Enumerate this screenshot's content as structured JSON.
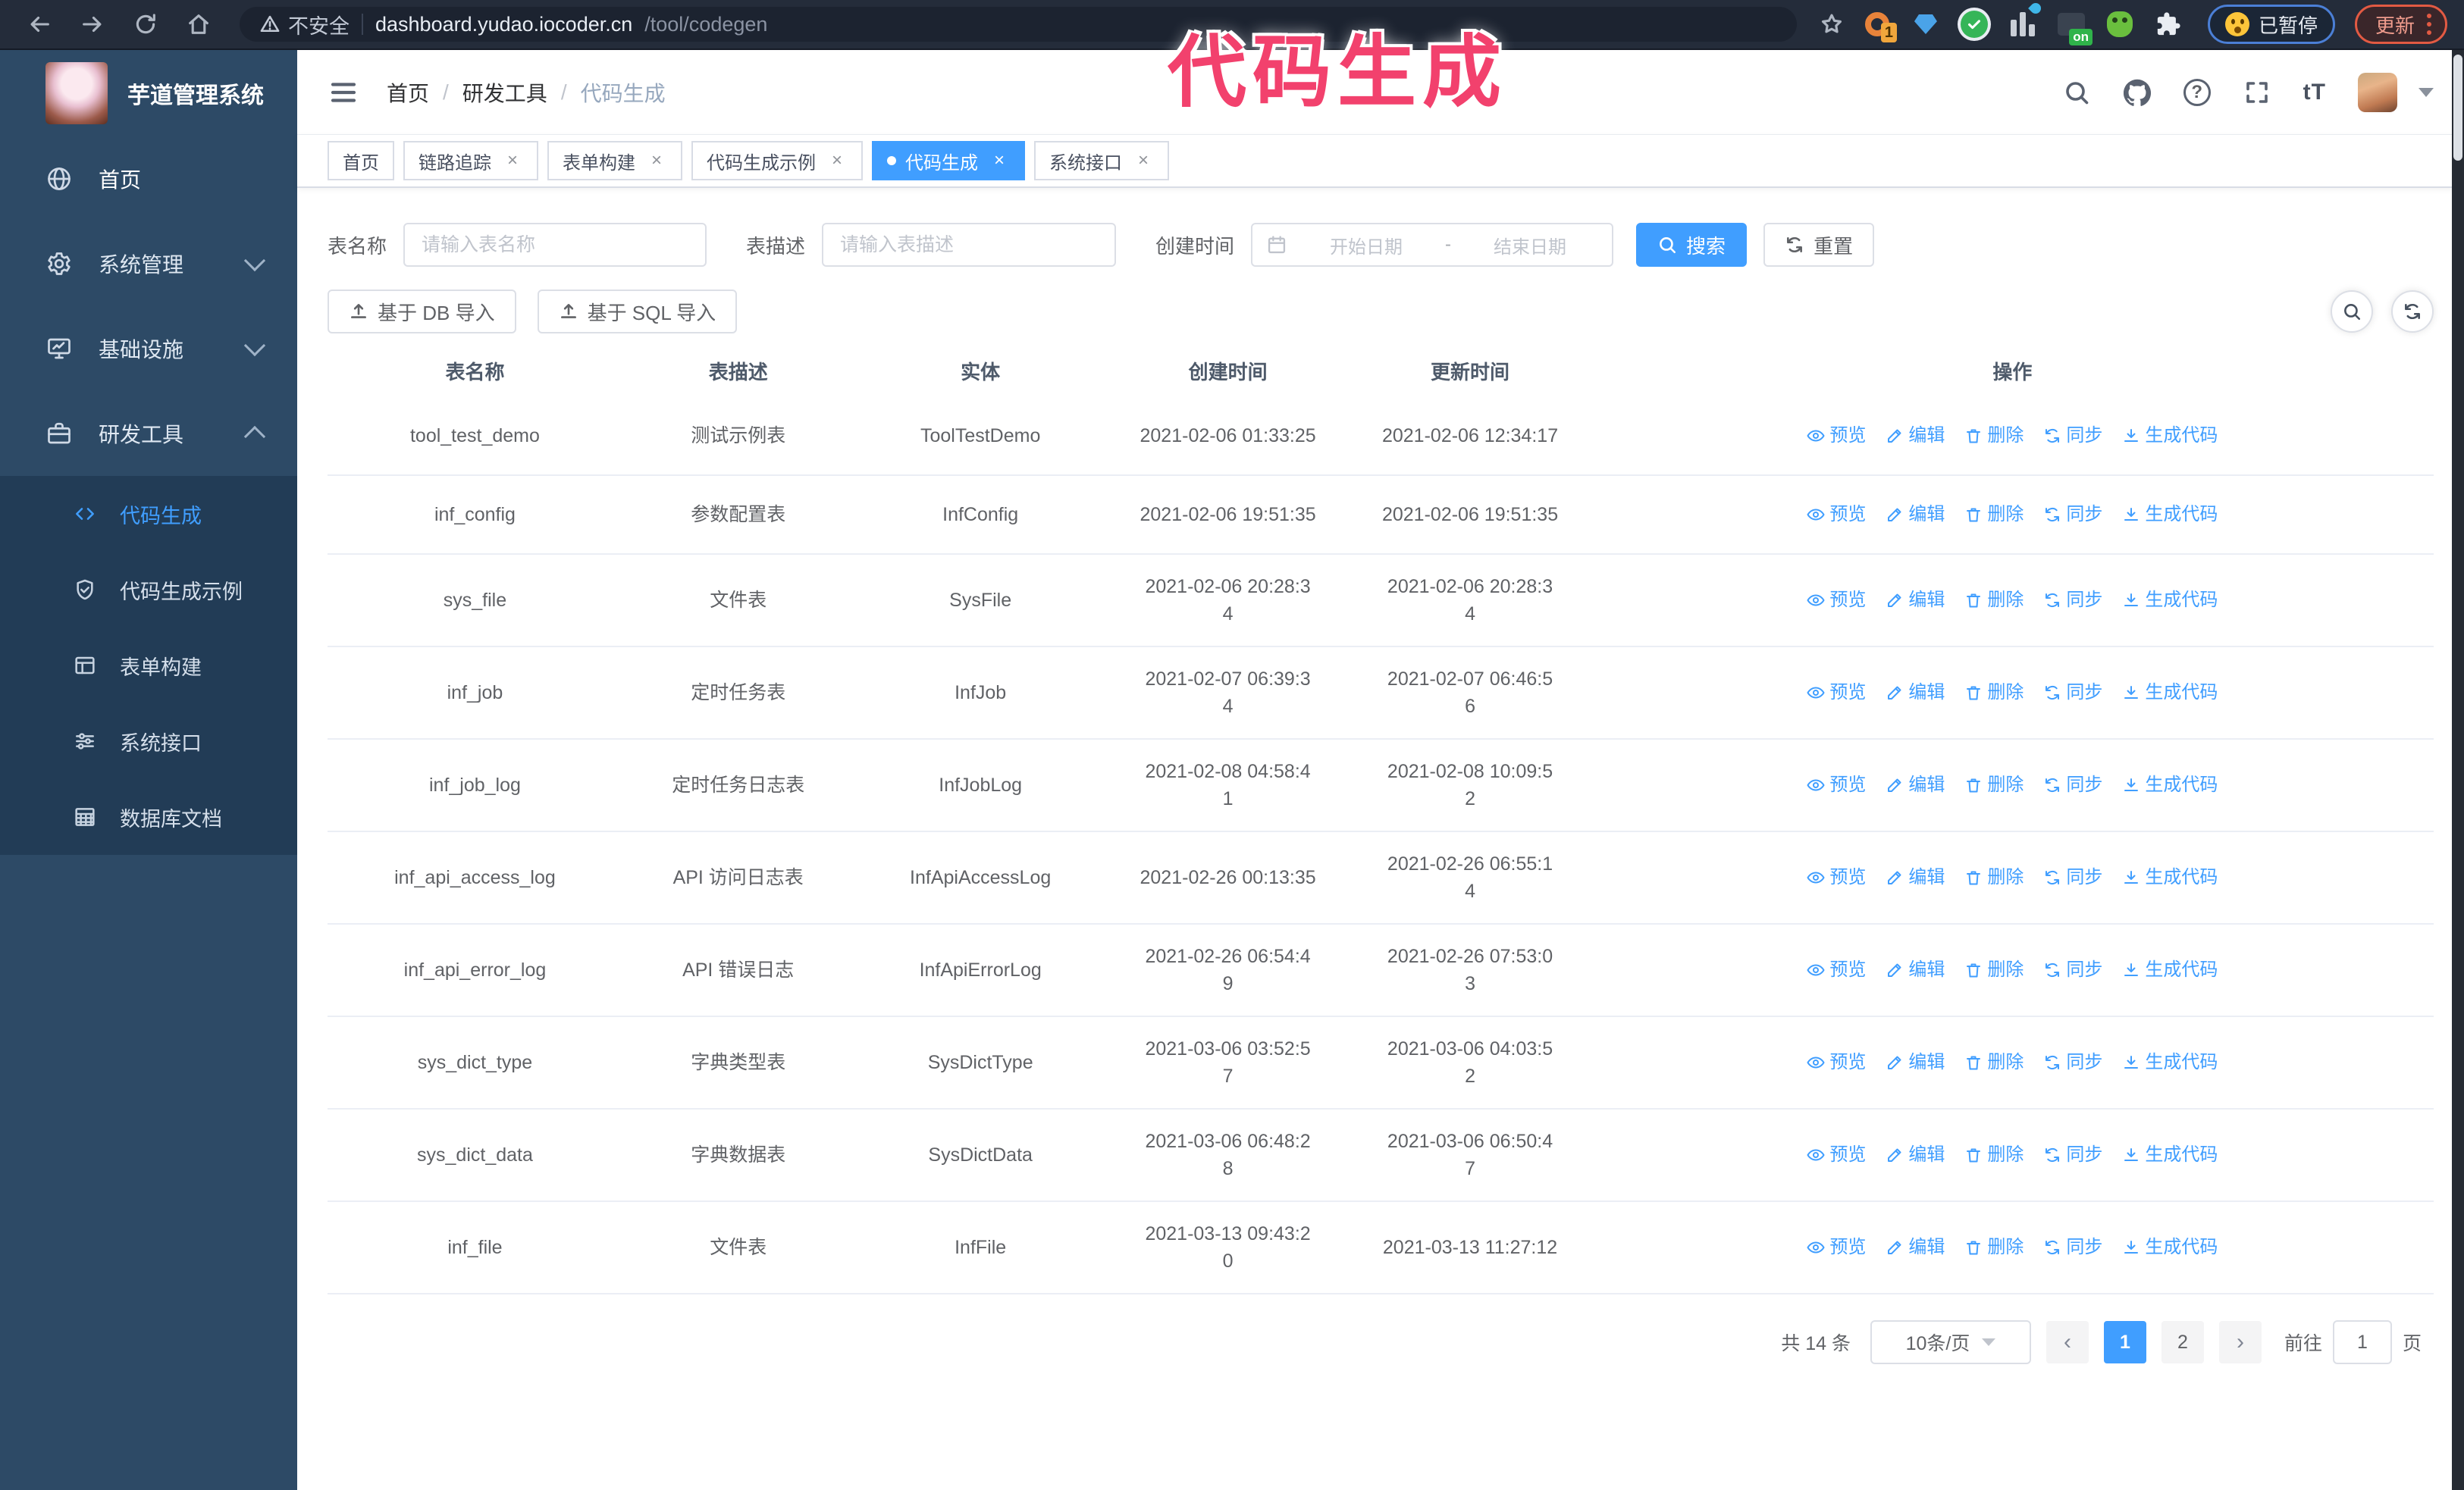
{
  "browser": {
    "security_warning": "不安全",
    "url_host": "dashboard.yudao.iocoder.cn",
    "url_path": "/tool/codegen",
    "extension_badge_1": "1",
    "extension_badge_on": "on",
    "paused_badge": "已暂停",
    "update_button": "更新"
  },
  "annotation": {
    "text": "代码生成",
    "color": "#f2416d"
  },
  "sidebar": {
    "app_title": "芋道管理系统",
    "items": [
      {
        "label": "首页",
        "icon": "globe-icon"
      },
      {
        "label": "系统管理",
        "icon": "gear-icon",
        "state": "collapsed"
      },
      {
        "label": "基础设施",
        "icon": "monitor-icon",
        "state": "collapsed"
      },
      {
        "label": "研发工具",
        "icon": "toolbox-icon",
        "state": "expanded"
      }
    ],
    "submenu": [
      {
        "label": "代码生成",
        "icon": "code-icon",
        "active": true
      },
      {
        "label": "代码生成示例",
        "icon": "badge-check-icon",
        "active": false
      },
      {
        "label": "表单构建",
        "icon": "form-icon",
        "active": false
      },
      {
        "label": "系统接口",
        "icon": "sliders-icon",
        "active": false
      },
      {
        "label": "数据库文档",
        "icon": "database-doc-icon",
        "active": false
      }
    ]
  },
  "header": {
    "breadcrumb": [
      "首页",
      "研发工具",
      "代码生成"
    ],
    "breadcrumb_separator": "/",
    "icons": [
      "search-icon",
      "github-icon",
      "help-icon",
      "fullscreen-icon",
      "font-size-icon",
      "avatar",
      "caret-down-icon"
    ]
  },
  "tabs": [
    {
      "label": "首页",
      "closable": false,
      "active": false
    },
    {
      "label": "链路追踪",
      "closable": true,
      "active": false
    },
    {
      "label": "表单构建",
      "closable": true,
      "active": false
    },
    {
      "label": "代码生成示例",
      "closable": true,
      "active": false
    },
    {
      "label": "代码生成",
      "closable": true,
      "active": true
    },
    {
      "label": "系统接口",
      "closable": true,
      "active": false
    }
  ],
  "search_form": {
    "table_name_label": "表名称",
    "table_name_placeholder": "请输入表名称",
    "table_desc_label": "表描述",
    "table_desc_placeholder": "请输入表描述",
    "create_time_label": "创建时间",
    "start_placeholder": "开始日期",
    "range_separator": "-",
    "end_placeholder": "结束日期",
    "search_button": "搜索",
    "reset_button": "重置"
  },
  "toolbar": {
    "import_db_button": "基于 DB 导入",
    "import_sql_button": "基于 SQL 导入"
  },
  "table": {
    "columns": [
      "表名称",
      "表描述",
      "实体",
      "创建时间",
      "更新时间",
      "操作"
    ],
    "row_actions": [
      "预览",
      "编辑",
      "删除",
      "同步",
      "生成代码"
    ],
    "rows": [
      {
        "name": "tool_test_demo",
        "desc": "测试示例表",
        "entity": "ToolTestDemo",
        "created": "2021-02-06 01:33:25",
        "updated": "2021-02-06 12:34:17"
      },
      {
        "name": "inf_config",
        "desc": "参数配置表",
        "entity": "InfConfig",
        "created": "2021-02-06 19:51:35",
        "updated": "2021-02-06 19:51:35"
      },
      {
        "name": "sys_file",
        "desc": "文件表",
        "entity": "SysFile",
        "created": "2021-02-06 20:28:3\n4",
        "updated": "2021-02-06 20:28:3\n4"
      },
      {
        "name": "inf_job",
        "desc": "定时任务表",
        "entity": "InfJob",
        "created": "2021-02-07 06:39:3\n4",
        "updated": "2021-02-07 06:46:5\n6"
      },
      {
        "name": "inf_job_log",
        "desc": "定时任务日志表",
        "entity": "InfJobLog",
        "created": "2021-02-08 04:58:4\n1",
        "updated": "2021-02-08 10:09:5\n2"
      },
      {
        "name": "inf_api_access_log",
        "desc": "API 访问日志表",
        "entity": "InfApiAccessLog",
        "created": "2021-02-26 00:13:35",
        "updated": "2021-02-26 06:55:1\n4"
      },
      {
        "name": "inf_api_error_log",
        "desc": "API 错误日志",
        "entity": "InfApiErrorLog",
        "created": "2021-02-26 06:54:4\n9",
        "updated": "2021-02-26 07:53:0\n3"
      },
      {
        "name": "sys_dict_type",
        "desc": "字典类型表",
        "entity": "SysDictType",
        "created": "2021-03-06 03:52:5\n7",
        "updated": "2021-03-06 04:03:5\n2"
      },
      {
        "name": "sys_dict_data",
        "desc": "字典数据表",
        "entity": "SysDictData",
        "created": "2021-03-06 06:48:2\n8",
        "updated": "2021-03-06 06:50:4\n7"
      },
      {
        "name": "inf_file",
        "desc": "文件表",
        "entity": "InfFile",
        "created": "2021-03-13 09:43:2\n0",
        "updated": "2021-03-13 11:27:12"
      }
    ]
  },
  "pagination": {
    "total": "共 14 条",
    "page_size": "10条/页",
    "prev": "‹",
    "next": "›",
    "pages": [
      "1",
      "2"
    ],
    "active_page": "1",
    "goto_label": "前往",
    "goto_value": "1",
    "goto_suffix": "页"
  }
}
